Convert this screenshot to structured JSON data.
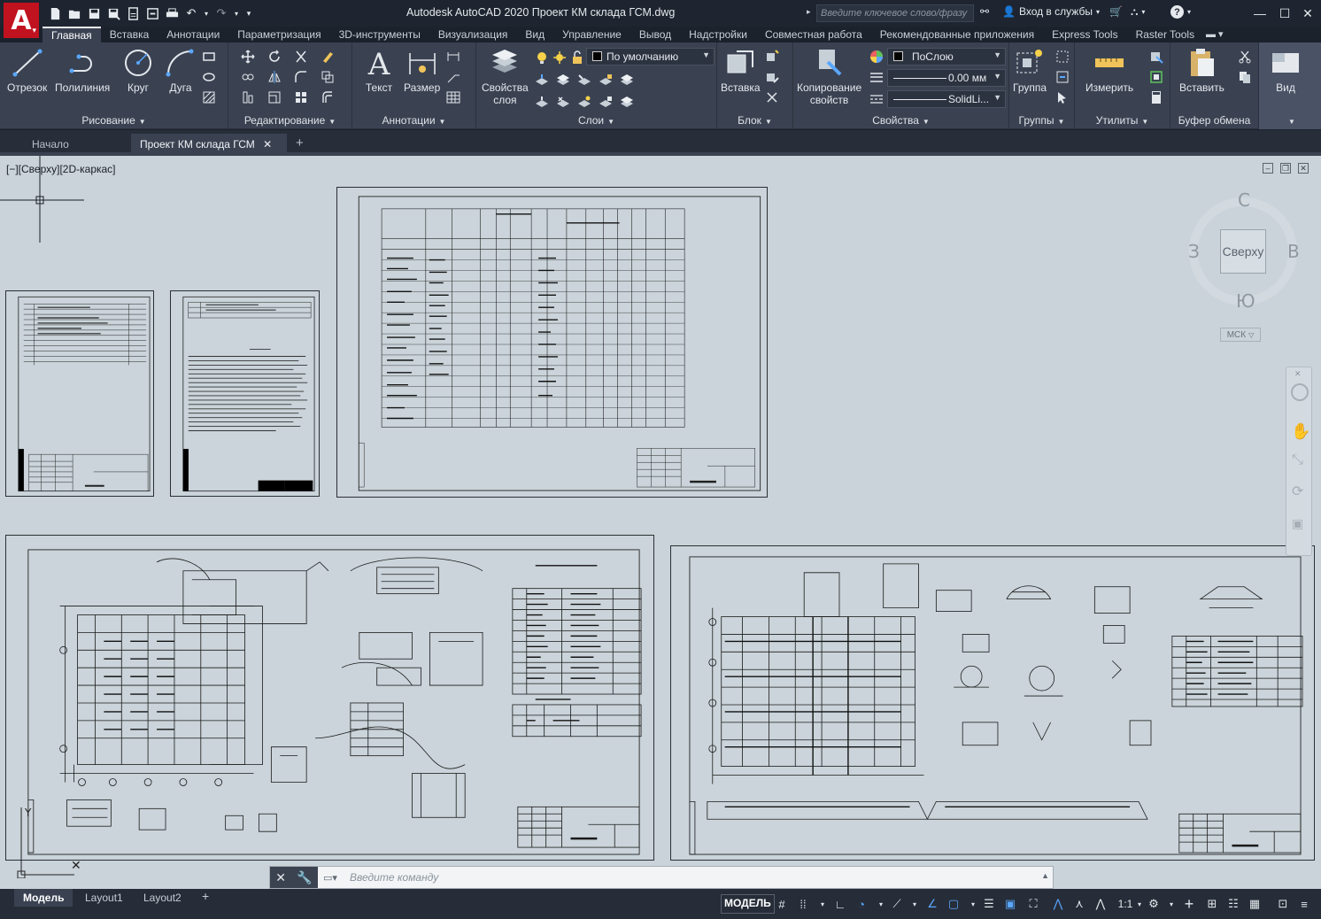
{
  "app": {
    "logo_letter": "A",
    "title": "Autodesk AutoCAD 2020   Проект КМ склада ГСМ.dwg",
    "search_placeholder": "Введите ключевое слово/фразу",
    "sign_in": "Вход в службы",
    "colors": {
      "brand": "#c1121f",
      "ribbon": "#3a4252",
      "model_bg": "#c9d3d9",
      "accent": "#5aa7ff"
    }
  },
  "quick_access": [
    "new-icon",
    "open-icon",
    "save-icon",
    "save-as-icon",
    "cloud-save-icon",
    "share-icon",
    "print-icon",
    "undo-icon",
    "redo-icon"
  ],
  "ribbon": {
    "tabs": [
      {
        "label": "Главная",
        "active": true
      },
      {
        "label": "Вставка"
      },
      {
        "label": "Аннотации"
      },
      {
        "label": "Параметризация"
      },
      {
        "label": "3D-инструменты"
      },
      {
        "label": "Визуализация"
      },
      {
        "label": "Вид"
      },
      {
        "label": "Управление"
      },
      {
        "label": "Вывод"
      },
      {
        "label": "Надстройки"
      },
      {
        "label": "Совместная работа"
      },
      {
        "label": "Рекомендованные приложения"
      },
      {
        "label": "Express Tools"
      },
      {
        "label": "Raster Tools"
      }
    ],
    "panels": {
      "draw": {
        "title": "Рисование",
        "line": "Отрезок",
        "polyline": "Полилиния",
        "circle": "Круг",
        "arc": "Дуга"
      },
      "modify": {
        "title": "Редактирование"
      },
      "annotation": {
        "title": "Аннотации",
        "text": "Текст",
        "dimension": "Размер"
      },
      "layers": {
        "title": "Слои",
        "properties_line1": "Свойства",
        "properties_line2": "слоя",
        "current_layer": "По умолчанию"
      },
      "block": {
        "title": "Блок",
        "insert": "Вставка"
      },
      "properties": {
        "title": "Свойства",
        "match_line1": "Копирование",
        "match_line2": "свойств",
        "color": "ПоСлою",
        "lineweight": "0.00 мм",
        "linetype": "SolidLi..."
      },
      "groups": {
        "title": "Группы",
        "group": "Группа"
      },
      "utilities": {
        "title": "Утилиты",
        "measure": "Измерить"
      },
      "clipboard": {
        "title": "Буфер обмена",
        "paste": "Вставить"
      },
      "view": {
        "title": "",
        "view": "Вид"
      }
    }
  },
  "document_tabs": [
    {
      "label": "Начало"
    },
    {
      "label": "Проект КМ склада ГСМ",
      "active": true
    }
  ],
  "viewport": {
    "label": "[−][Сверху][2D-каркас]",
    "viewcube": {
      "north": "С",
      "south": "Ю",
      "west": "З",
      "east": "В",
      "face": "Сверху",
      "wcs": "МСК"
    }
  },
  "command_line": {
    "placeholder": "Введите команду"
  },
  "layout_tabs": [
    {
      "label": "Модель",
      "active": true
    },
    {
      "label": "Layout1"
    },
    {
      "label": "Layout2"
    }
  ],
  "status": {
    "model": "МОДЕЛЬ",
    "scale": "1:1"
  }
}
